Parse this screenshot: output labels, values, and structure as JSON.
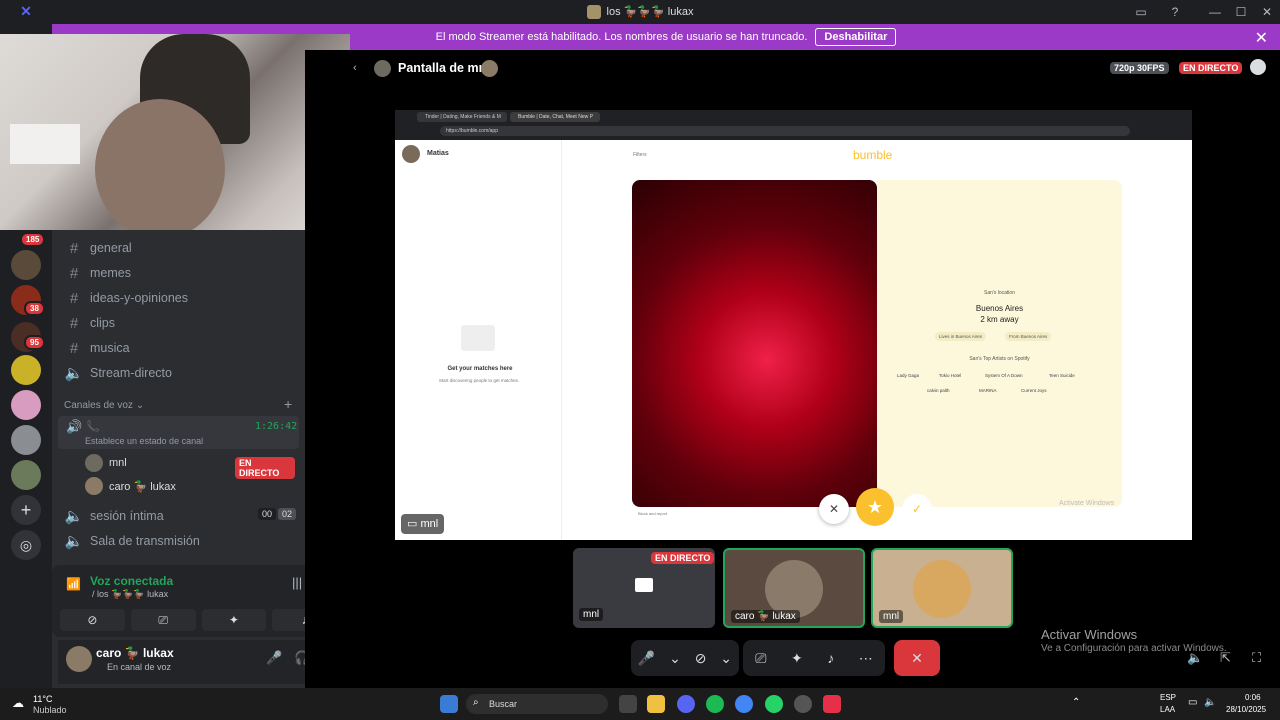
{
  "window": {
    "title": "los 🦆🦆🦆 lukax"
  },
  "streamer_banner": {
    "text": "El modo Streamer está habilitado. Los nombres de usuario se han truncado.",
    "button": "Deshabilitar"
  },
  "stream_header": {
    "title": "Pantalla de mnl",
    "quality": "720p 30FPS",
    "live": "EN DIRECTO"
  },
  "servers": {
    "badges": [
      "185",
      "38",
      "95"
    ]
  },
  "channels": {
    "text": [
      "general",
      "memes",
      "ideas-y-opiniones",
      "clips",
      "musica"
    ],
    "stage": "Stream-directo",
    "voice_header": "Canales de voz",
    "active_voice": {
      "timer": "1:26:42",
      "status": "Establece un estado de canal",
      "users": [
        {
          "name": "mnl",
          "badge": "EN DIRECTO"
        },
        {
          "name": "caro 🦆 lukax"
        }
      ]
    },
    "other_voice": [
      {
        "name": "sesión íntima",
        "count_a": "00",
        "count_b": "02"
      },
      {
        "name": "Sala de transmisión"
      }
    ]
  },
  "voice_panel": {
    "status": "Voz conectada",
    "channel": "/ los 🦆🦆🦆 lukax"
  },
  "user_panel": {
    "name": "caro 🦆 lukax",
    "status": "En canal de voz"
  },
  "shared_screen": {
    "tabs": [
      "Tinder | Dating, Make Friends & M",
      "Bumble | Date, Chat, Meet New P"
    ],
    "url": "https://bumble.com/app",
    "profile_name": "Matias",
    "filters": "Filters",
    "brand": "bumble",
    "empty_title": "Get your matches here",
    "empty_sub": "Start discovering people to get matches.",
    "location_label": "San's location",
    "location_city": "Buenos Aires",
    "location_dist": "2 km away",
    "chips": [
      "Lives in Buenos Aires",
      "From Buenos Aires"
    ],
    "artists_label": "San's Top Artists on Spotify",
    "artists": [
      "Lady Gaga",
      "Tokio Hotel",
      "System Of A Down",
      "Teen Suicide",
      "calvin palth",
      "MARINA",
      "Current Joys"
    ],
    "block": "Block and report",
    "feedback": "Feedback",
    "activate_windows": "Activate Windows",
    "activate_windows_sub": "Go to Settings to activate Windows.",
    "owner_label": "mnl"
  },
  "tiles": [
    {
      "label": "mnl",
      "badge": "EN DIRECTO"
    },
    {
      "label": "caro 🦆 lukax"
    },
    {
      "label": "mnl"
    }
  ],
  "activate": {
    "title": "Activar Windows",
    "sub": "Ve a Configuración para activar Windows."
  },
  "taskbar": {
    "weather_temp": "11°C",
    "weather_desc": "Nublado",
    "search": "Buscar",
    "lang1": "ESP",
    "lang2": "LAA",
    "time": "0:06",
    "date": "28/10/2025"
  },
  "colors": {
    "streamer": "#9b3ac6",
    "live": "#da373c",
    "green": "#23a55a",
    "bumble": "#fbc02d"
  }
}
